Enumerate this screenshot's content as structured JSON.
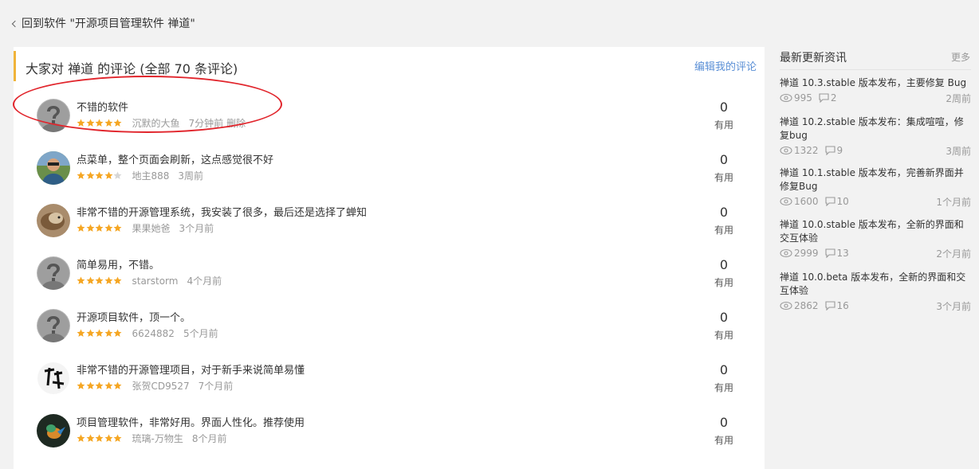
{
  "back": {
    "label": "回到软件 \"开源项目管理软件 禅道\""
  },
  "main": {
    "title": "大家对 禅道 的评论 (全部 70 条评论)",
    "edit_label": "编辑我的评论"
  },
  "reviews": [
    {
      "text": "不错的软件",
      "rating": 5,
      "user": "沉默的大鱼",
      "time": "7分钟前",
      "action": "删除",
      "useful_count": "0",
      "useful_label": "有用",
      "avatar": "default-avatar"
    },
    {
      "text": "点菜单，整个页面会刷新，这点感觉很不好",
      "rating": 4,
      "user": "地主888",
      "time": "3周前",
      "action": "",
      "useful_count": "0",
      "useful_label": "有用",
      "avatar": "photo-avatar"
    },
    {
      "text": "非常不错的开源管理系统，我安装了很多，最后还是选择了蝉知",
      "rating": 5,
      "user": "果果她爸",
      "time": "3个月前",
      "action": "",
      "useful_count": "0",
      "useful_label": "有用",
      "avatar": "photo-avatar"
    },
    {
      "text": "简单易用，不错。",
      "rating": 5,
      "user": "starstorm",
      "time": "4个月前",
      "action": "",
      "useful_count": "0",
      "useful_label": "有用",
      "avatar": "default-avatar"
    },
    {
      "text": "开源项目软件，顶一个。",
      "rating": 5,
      "user": "6624882",
      "time": "5个月前",
      "action": "",
      "useful_count": "0",
      "useful_label": "有用",
      "avatar": "default-avatar"
    },
    {
      "text": "非常不错的开源管理项目，对于新手来说简单易懂",
      "rating": 5,
      "user": "张贺CD9527",
      "time": "7个月前",
      "action": "",
      "useful_count": "0",
      "useful_label": "有用",
      "avatar": "photo-avatar"
    },
    {
      "text": "项目管理软件，非常好用。界面人性化。推荐使用",
      "rating": 5,
      "user": "琉璃-万物生",
      "time": "8个月前",
      "action": "",
      "useful_count": "0",
      "useful_label": "有用",
      "avatar": "photo-avatar"
    }
  ],
  "sidebar": {
    "title": "最新更新资讯",
    "more_label": "更多",
    "news": [
      {
        "title": "禅道 10.3.stable 版本发布，主要修复 Bug",
        "views": "995",
        "comments": "2",
        "time": "2周前"
      },
      {
        "title": "禅道 10.2.stable 版本发布：集成喧喧，修复bug",
        "views": "1322",
        "comments": "9",
        "time": "3周前"
      },
      {
        "title": "禅道 10.1.stable 版本发布，完善新界面并修复Bug",
        "views": "1600",
        "comments": "10",
        "time": "1个月前"
      },
      {
        "title": "禅道 10.0.stable 版本发布，全新的界面和交互体验",
        "views": "2999",
        "comments": "13",
        "time": "2个月前"
      },
      {
        "title": "禅道 10.0.beta 版本发布，全新的界面和交互体验",
        "views": "2862",
        "comments": "16",
        "time": "3个月前"
      }
    ]
  },
  "colors": {
    "accent": "#f0b43a",
    "link": "#5a8fd6",
    "star": "#f5a623",
    "highlight": "#e1252c"
  }
}
